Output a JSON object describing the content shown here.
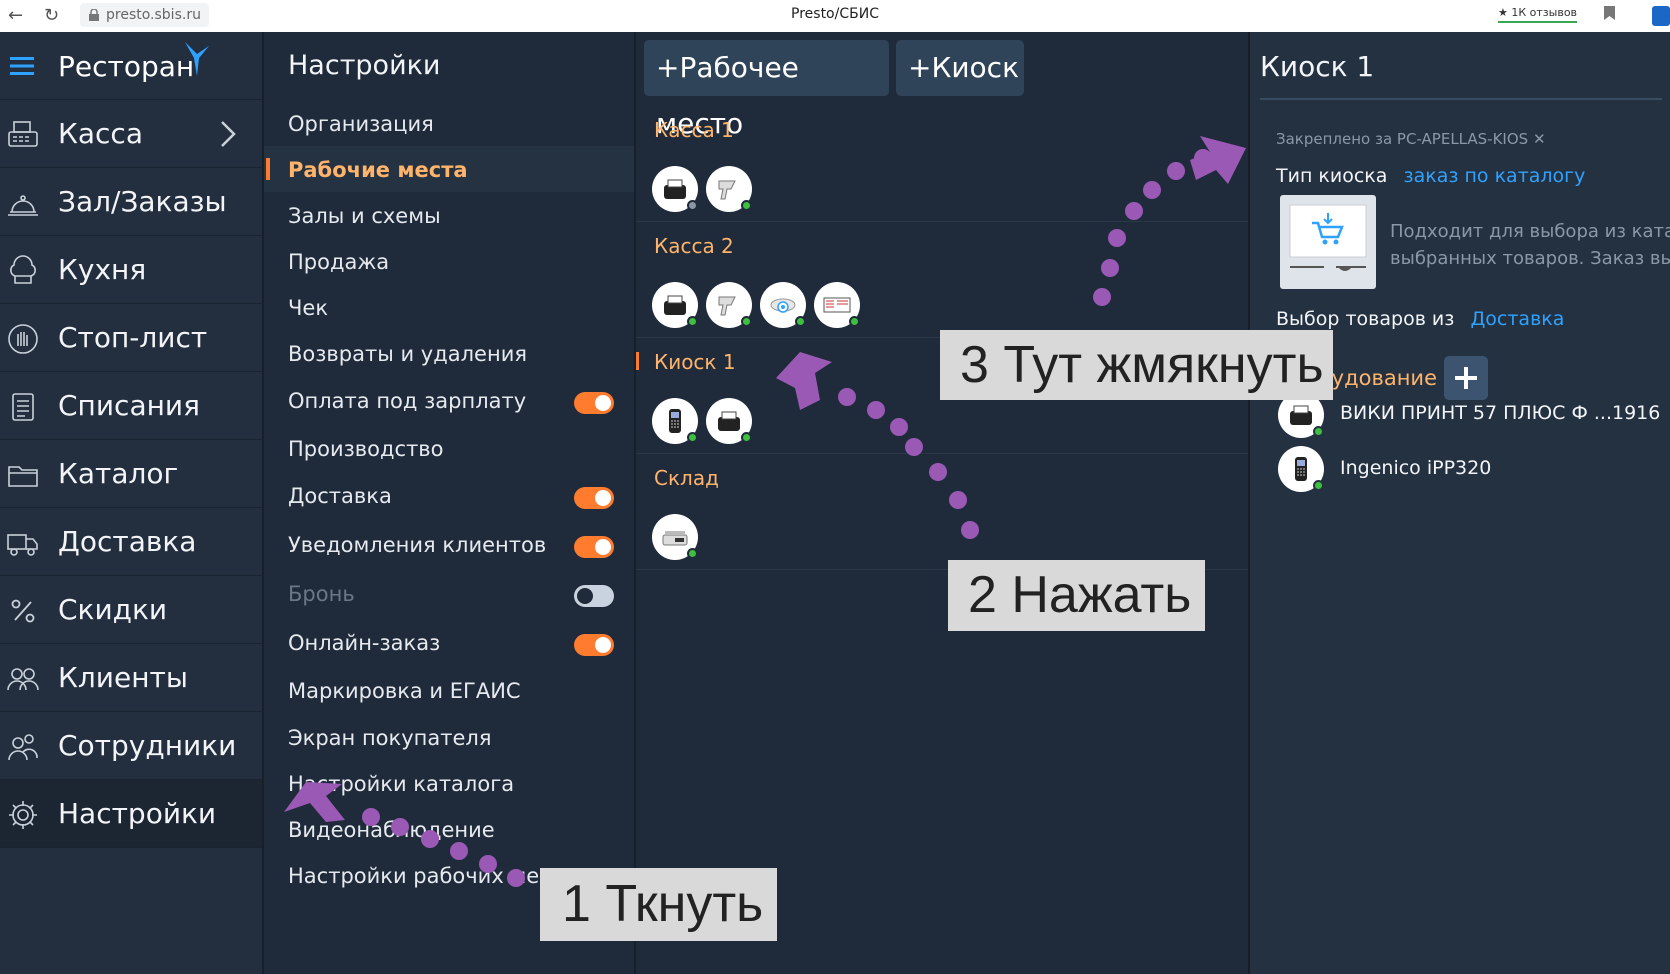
{
  "browser": {
    "url": "presto.sbis.ru",
    "title": "Presto/СБИС",
    "reviews": "1К отзывов"
  },
  "leftnav": {
    "brand": "Ресторан",
    "items": [
      {
        "label": "Касса",
        "icon": "cash-register-icon"
      },
      {
        "label": "Зал/Заказы",
        "icon": "cloche-icon"
      },
      {
        "label": "Кухня",
        "icon": "chef-hat-icon"
      },
      {
        "label": "Стоп-лист",
        "icon": "stop-hand-icon"
      },
      {
        "label": "Списания",
        "icon": "document-list-icon"
      },
      {
        "label": "Каталог",
        "icon": "folder-icon"
      },
      {
        "label": "Доставка",
        "icon": "delivery-truck-icon"
      },
      {
        "label": "Скидки",
        "icon": "percent-icon"
      },
      {
        "label": "Клиенты",
        "icon": "clients-icon"
      },
      {
        "label": "Сотрудники",
        "icon": "employees-icon"
      },
      {
        "label": "Настройки",
        "icon": "gear-icon"
      }
    ]
  },
  "settings": {
    "title": "Настройки",
    "items": [
      {
        "label": "Организация"
      },
      {
        "label": "Рабочие места",
        "active": true
      },
      {
        "label": "Залы и схемы"
      },
      {
        "label": "Продажа"
      },
      {
        "label": "Чек"
      },
      {
        "label": "Возвраты и удаления"
      },
      {
        "label": "Оплата под зарплату",
        "toggle": "on"
      },
      {
        "label": "Производство"
      },
      {
        "label": "Доставка",
        "toggle": "on"
      },
      {
        "label": "Уведомления клиентов",
        "toggle": "on"
      },
      {
        "label": "Бронь",
        "toggle": "off",
        "disabled": true
      },
      {
        "label": "Онлайн-заказ",
        "toggle": "on"
      },
      {
        "label": "Маркировка и ЕГАИС"
      },
      {
        "label": "Экран покупателя"
      },
      {
        "label": "Настройки каталога"
      },
      {
        "label": "Видеонаблюдение"
      },
      {
        "label": "Настройки рабочих мест"
      }
    ]
  },
  "workplaces": {
    "add_workplace": "+Рабочее место",
    "add_kiosk": "+Киоск",
    "groups": [
      {
        "name": "Касса 1",
        "devices": [
          "receipt-printer",
          "barcode-scanner"
        ]
      },
      {
        "name": "Касса 2",
        "devices": [
          "receipt-printer",
          "barcode-scanner",
          "camera",
          "display"
        ]
      },
      {
        "name": "Киоск 1",
        "devices": [
          "pos-terminal",
          "receipt-printer"
        ],
        "active": true
      },
      {
        "name": "Склад",
        "devices": [
          "scales"
        ]
      }
    ]
  },
  "kiosk": {
    "title": "Киоск 1",
    "pinned": "Закреплено за PC-APELLAS-KIOS",
    "type_label": "Тип киоска",
    "type_value": "заказ по каталогу",
    "desc_line1": "Подходит для выбора из катал",
    "desc_line2": "выбранных товаров. Заказ выд",
    "goods_label": "Выбор товаров из",
    "goods_value": "Доставка",
    "equipment_label": "Оборудование",
    "devices": [
      {
        "name": "ВИКИ ПРИНТ 57 ПЛЮС Ф ...1916"
      },
      {
        "name": "Ingenico iPP320"
      }
    ]
  },
  "annotations": {
    "step1": "1 Ткнуть",
    "step2": "2 Нажать",
    "step3": "3 Тут жмякнуть"
  },
  "colors": {
    "accent": "#ff7b2e",
    "label_orange": "#ffb36b",
    "link": "#2fa2ff",
    "arrow": "#9b59b6"
  }
}
